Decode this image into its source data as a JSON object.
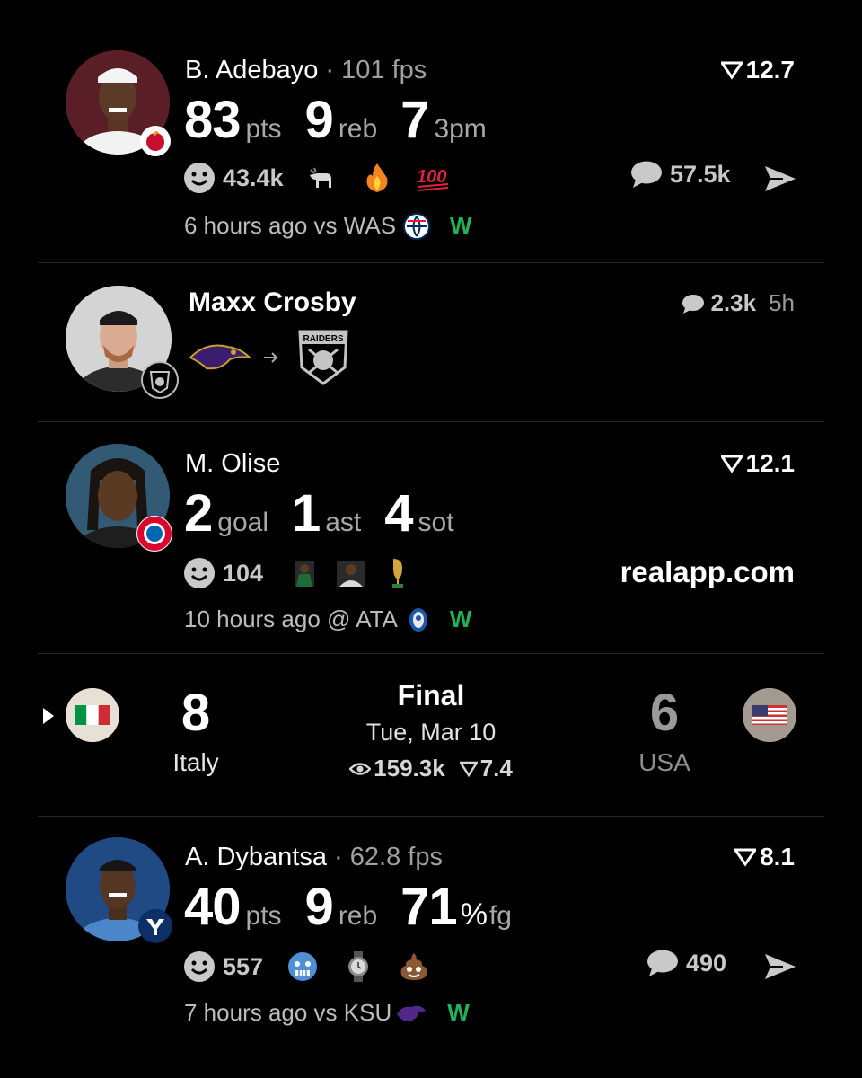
{
  "cards": [
    {
      "name": "B. Adebayo",
      "fps": "· 101 fps",
      "score": "12.7",
      "stats": [
        {
          "value": "83",
          "unit": "pts"
        },
        {
          "value": "9",
          "unit": "reb"
        },
        {
          "value": "7",
          "unit": "3pm"
        }
      ],
      "reaction_count": "43.4k",
      "reactions": [
        "goat-emoji",
        "fire-emoji",
        "hundred-emoji"
      ],
      "comment_count": "57.5k",
      "time_text": "6 hours ago vs WAS",
      "result": "W"
    },
    {
      "name": "Maxx Crosby",
      "comment_count": "2.3k",
      "age": "5h",
      "from_team": "ravens-logo",
      "to_team": "raiders-logo",
      "to_team_label": "RAIDERS"
    },
    {
      "name": "M. Olise",
      "score": "12.1",
      "stats": [
        {
          "value": "2",
          "unit": "goal"
        },
        {
          "value": "1",
          "unit": "ast"
        },
        {
          "value": "4",
          "unit": "sot"
        }
      ],
      "reaction_count": "104",
      "reactions": [
        "player-photo",
        "player-photo",
        "trophy-emoji"
      ],
      "watermark": "realapp.com",
      "time_text": "10 hours ago @ ATA",
      "result": "W"
    },
    {
      "status": "Final",
      "date": "Tue, Mar 10",
      "views": "159.3k",
      "score": "7.4",
      "home": {
        "name": "Italy",
        "score": "8"
      },
      "away": {
        "name": "USA",
        "score": "6"
      }
    },
    {
      "name": "A. Dybantsa",
      "fps": "· 62.8 fps",
      "score": "8.1",
      "stats": [
        {
          "value": "40",
          "unit": "pts"
        },
        {
          "value": "9",
          "unit": "reb"
        },
        {
          "value": "71",
          "unit": "fg",
          "pct": "%"
        }
      ],
      "reaction_count": "557",
      "reactions": [
        "cold-face-emoji",
        "watch-emoji",
        "poop-emoji"
      ],
      "comment_count": "490",
      "time_text": "7 hours ago vs KSU",
      "result": "W"
    }
  ],
  "colors": {
    "background": "#000000",
    "win": "#22b35a",
    "muted": "#a0a0a0"
  }
}
